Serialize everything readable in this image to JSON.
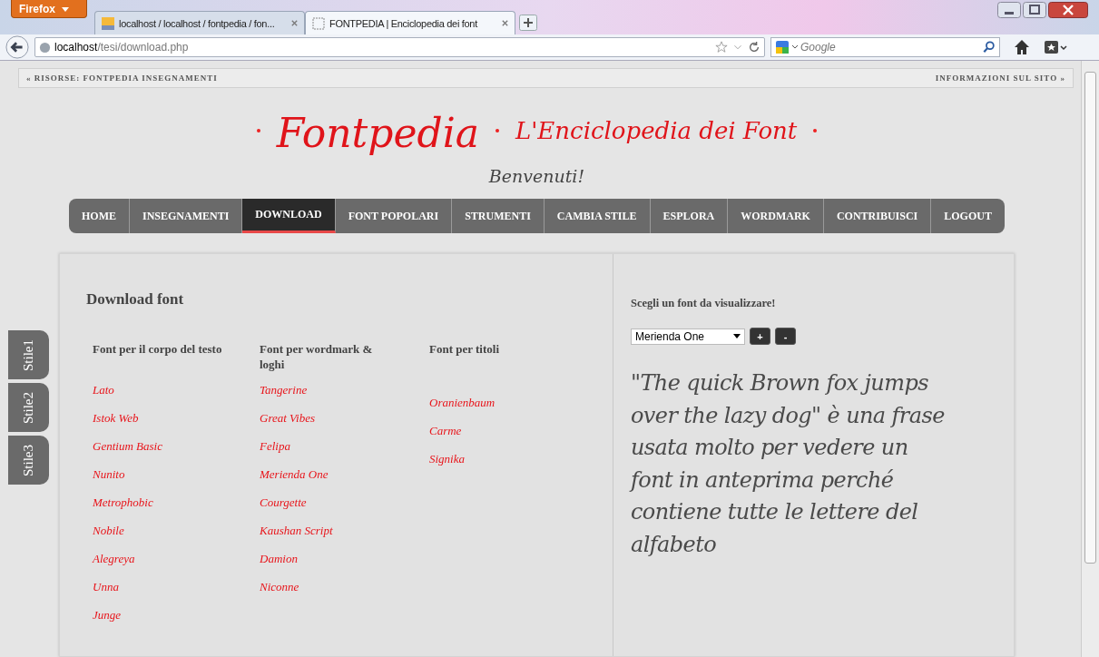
{
  "browser": {
    "menu_button": "Firefox",
    "tabs": [
      {
        "title": "localhost / localhost / fontpedia / fon...",
        "selected": false,
        "kind": "pma"
      },
      {
        "title": "FONTPEDIA | Enciclopedia dei font",
        "selected": true,
        "kind": "blank"
      }
    ],
    "address": {
      "host": "localhost",
      "path": "/tesi/download.php"
    },
    "search": {
      "placeholder": "Google"
    }
  },
  "top_bar": {
    "left_link": "« RISORSE: FONTPEDIA INSEGNAMENTI",
    "right_link": "INFORMAZIONI SUL SITO »"
  },
  "header": {
    "title": "Fontpedia",
    "subtitle": "L'Enciclopedia dei Font",
    "welcome": "Benvenuti!"
  },
  "nav": [
    {
      "label": "HOME",
      "selected": false
    },
    {
      "label": "INSEGNAMENTI",
      "selected": false
    },
    {
      "label": "DOWNLOAD",
      "selected": true
    },
    {
      "label": "FONT POPOLARI",
      "selected": false
    },
    {
      "label": "STRUMENTI",
      "selected": false
    },
    {
      "label": "CAMBIA STILE",
      "selected": false
    },
    {
      "label": "ESPLORA",
      "selected": false
    },
    {
      "label": "WORDMARK",
      "selected": false
    },
    {
      "label": "CONTRIBUISCI",
      "selected": false
    },
    {
      "label": "LOGOUT",
      "selected": false
    }
  ],
  "style_tabs": [
    "Stile1",
    "Stile2",
    "Stile3"
  ],
  "download": {
    "heading": "Download font",
    "columns": [
      {
        "heading": "Font per il corpo del testo",
        "fonts": [
          "Lato",
          "Istok Web",
          "Gentium Basic",
          "Nunito",
          "Metrophobic",
          "Nobile",
          "Alegreya",
          "Unna",
          "Junge"
        ]
      },
      {
        "heading": "Font per wordmark & loghi",
        "fonts": [
          "Tangerine",
          "Great Vibes",
          "Felipa",
          "Merienda One",
          "Courgette",
          "Kaushan Script",
          "Damion",
          "Niconne"
        ]
      },
      {
        "heading": "Font per titoli",
        "fonts": [
          "Oranienbaum",
          "Carme",
          "Signika"
        ]
      }
    ]
  },
  "preview": {
    "label": "Scegli un font da visualizzare!",
    "font_select": "Merienda One",
    "buttons": [
      "+",
      "-"
    ],
    "sample": "\"The quick Brown fox jumps over the lazy dog\" è una frase usata molto per vedere un font in anteprima perché contiene tutte le lettere del alfabeto"
  }
}
